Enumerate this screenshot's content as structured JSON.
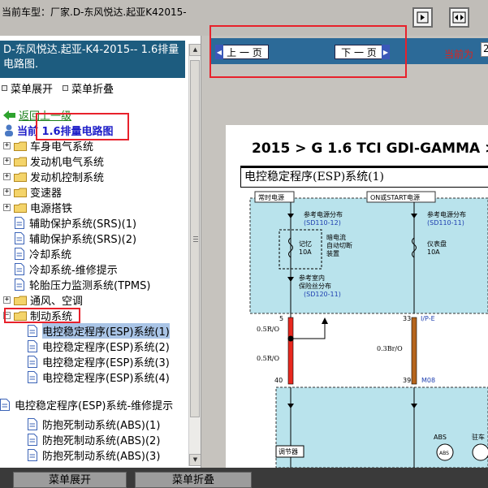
{
  "header": {
    "breadcrumb": "当前车型：厂家.D-东风悦达.起亚K42015-"
  },
  "sidebar": {
    "title": "D-东风悦达.起亚-K4-2015-- 1.6排量电路图.",
    "expand_label": "菜单展开",
    "collapse_label": "菜单折叠",
    "back_label": "返回上一级",
    "current_label": "当前 1.6排量电路图",
    "items": [
      {
        "label": "车身电气系统",
        "type": "folder"
      },
      {
        "label": "发动机电气系统",
        "type": "folder"
      },
      {
        "label": "发动机控制系统",
        "type": "folder"
      },
      {
        "label": "变速器",
        "type": "folder"
      },
      {
        "label": "电源搭铁",
        "type": "folder"
      },
      {
        "label": "辅助保护系统(SRS)(1)",
        "type": "doc"
      },
      {
        "label": "辅助保护系统(SRS)(2)",
        "type": "doc"
      },
      {
        "label": "冷却系统",
        "type": "doc"
      },
      {
        "label": "冷却系统-维修提示",
        "type": "doc"
      },
      {
        "label": "轮胎压力监测系统(TPMS)",
        "type": "doc"
      },
      {
        "label": "通风、空调",
        "type": "folder"
      },
      {
        "label": "制动系统",
        "type": "folder-open"
      },
      {
        "label": "电控稳定程序(ESP)系统(1)",
        "type": "doc",
        "selected": true
      },
      {
        "label": "电控稳定程序(ESP)系统(2)",
        "type": "doc"
      },
      {
        "label": "电控稳定程序(ESP)系统(3)",
        "type": "doc"
      },
      {
        "label": "电控稳定程序(ESP)系统(4)",
        "type": "doc"
      },
      {
        "label": "电控稳定程序(ESP)系统-维修提示",
        "type": "doc"
      },
      {
        "label": "防抱死制动系统(ABS)(1)",
        "type": "doc"
      },
      {
        "label": "防抱死制动系统(ABS)(2)",
        "type": "doc"
      },
      {
        "label": "防抱死制动系统(ABS)(3)",
        "type": "doc"
      }
    ]
  },
  "nav": {
    "prev_label": "上 一 页",
    "next_label": "下 一 页",
    "page_label": "当前为",
    "page_value": "2"
  },
  "document": {
    "title": "2015 > G 1.6 TCI GDI-GAMMA > ",
    "section": "电控稳定程序(ESP)系统(1)",
    "diagram": {
      "always_power": "常时电源",
      "on_start_power": "ON或START电源",
      "ref_power_dist_1": "参考电源分布",
      "ref_power_code_1": "(SD110-12)",
      "ref_power_dist_2": "参考电源分布",
      "ref_power_code_2": "(SD110-11)",
      "memory_fuse_name": "记忆",
      "memory_fuse_amp": "10A",
      "auto_cut_1": "暗电流",
      "auto_cut_2": "自动切断",
      "auto_cut_3": "装置",
      "instrument_fuse_name": "仪表盘",
      "instrument_fuse_amp": "10A",
      "ref_indoor_1": "参考室内",
      "ref_indoor_2": "保险丝分布",
      "ref_indoor_code": "(SD120-11)",
      "pin_5": "5",
      "pin_33": "33",
      "ip_e": "I/P-E",
      "wire_left_1": "0.5R/O",
      "wire_left_2": "0.5R/O",
      "wire_right": "0.3Br/O",
      "pin_40": "40",
      "pin_39": "39",
      "m08": "M08",
      "abs_label": "ABS",
      "regulator": "调节器",
      "park_label": "驻车"
    }
  },
  "footer": {
    "expand_label": "菜单展开",
    "collapse_label": "菜单折叠"
  },
  "colors": {
    "accent": "#1d5c7f",
    "nav_bar": "#2c6a98",
    "annotation_red": "#e8212b",
    "diagram_bg": "#b9e3ec",
    "wire_red": "#e8281f",
    "wire_brown": "#b5651d"
  }
}
